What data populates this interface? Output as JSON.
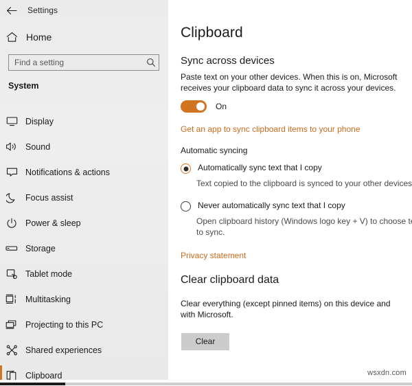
{
  "window": {
    "app_title": "Settings",
    "back_icon": "back-arrow-icon"
  },
  "sidebar": {
    "home": {
      "label": "Home",
      "icon": "home-icon"
    },
    "search": {
      "value": "",
      "placeholder": "Find a setting",
      "icon": "search-icon"
    },
    "group_title": "System",
    "items": [
      {
        "label": "Display",
        "icon": "monitor-icon",
        "active": false
      },
      {
        "label": "Sound",
        "icon": "speaker-icon",
        "active": false
      },
      {
        "label": "Notifications & actions",
        "icon": "notification-icon",
        "active": false
      },
      {
        "label": "Focus assist",
        "icon": "moon-icon",
        "active": false
      },
      {
        "label": "Power & sleep",
        "icon": "power-icon",
        "active": false
      },
      {
        "label": "Storage",
        "icon": "drive-icon",
        "active": false
      },
      {
        "label": "Tablet mode",
        "icon": "tablet-icon",
        "active": false
      },
      {
        "label": "Multitasking",
        "icon": "multitasking-icon",
        "active": false
      },
      {
        "label": "Projecting to this PC",
        "icon": "project-screen-icon",
        "active": false
      },
      {
        "label": "Shared experiences",
        "icon": "share-nodes-icon",
        "active": false
      },
      {
        "label": "Clipboard",
        "icon": "clipboard-icon",
        "active": true
      }
    ]
  },
  "content": {
    "page_title": "Clipboard",
    "sync_section": {
      "heading": "Sync across devices",
      "description": "Paste text on your other devices. When this is on, Microsoft receives your clipboard data to sync it across your devices.",
      "toggle_state": "On",
      "toggle_on": true,
      "phone_link": "Get an app to sync clipboard items to your phone"
    },
    "automatic_syncing": {
      "heading": "Automatic syncing",
      "options": [
        {
          "label": "Automatically sync text that I copy",
          "description": "Text copied to the clipboard is synced to your other devices.",
          "selected": true
        },
        {
          "label": "Never automatically sync text that I copy",
          "description": "Open clipboard history (Windows logo key + V) to choose text to sync.",
          "selected": false
        }
      ],
      "privacy_link": "Privacy statement"
    },
    "clear_section": {
      "heading": "Clear clipboard data",
      "description": "Clear everything (except pinned items) on this device and with Microsoft.",
      "button_label": "Clear"
    }
  },
  "watermark": "wsxdn.com",
  "colors": {
    "accent": "#d2741f",
    "link": "#c96a1c",
    "sidebar_bg": "#ebebeb",
    "content_bg": "#ffffff",
    "text": "#1a1a1a",
    "sub_text": "#4a4a4a"
  }
}
